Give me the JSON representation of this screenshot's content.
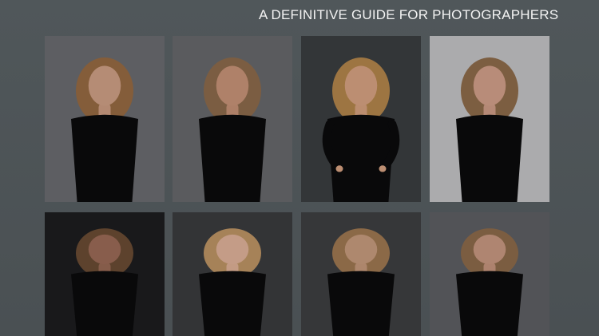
{
  "header": {
    "title": "A DEFINITIVE GUIDE FOR PHOTOGRAPHERS"
  },
  "grid": {
    "rows": 2,
    "columns": 4
  },
  "portraits": [
    {
      "background": "#6a6b70",
      "skin": "#cfa086",
      "hair": "#9a6a3f",
      "pose": "arms-down"
    },
    {
      "background": "#67686b",
      "skin": "#c89378",
      "hair": "#8e6a4b",
      "pose": "arms-down"
    },
    {
      "background": "#3b3e40",
      "skin": "#d7a282",
      "hair": "#b98a4d",
      "pose": "hands-on-hips"
    },
    {
      "background": "#c3c3c5",
      "skin": "#d2a08a",
      "hair": "#8b6745",
      "pose": "arms-down"
    },
    {
      "background": "#1d1d1f",
      "skin": "#9b6a57",
      "hair": "#6f4f36",
      "pose": "arms-down"
    },
    {
      "background": "#3b3c3e",
      "skin": "#e0b29a",
      "hair": "#c49a67",
      "pose": "arms-down"
    },
    {
      "background": "#3e3f41",
      "skin": "#c79b7e",
      "hair": "#a47b52",
      "pose": "arms-down"
    },
    {
      "background": "#5e5f63",
      "skin": "#c89881",
      "hair": "#8f6a4a",
      "pose": "arms-down"
    }
  ]
}
